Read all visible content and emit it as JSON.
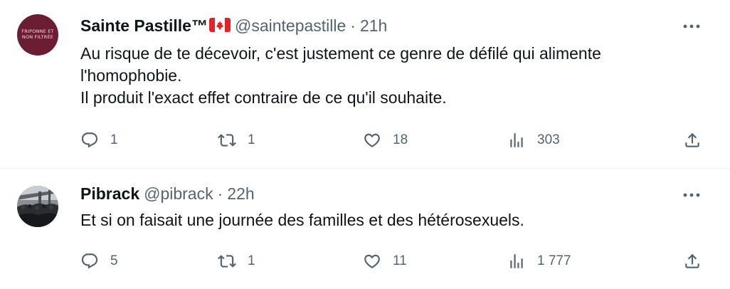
{
  "tweets": [
    {
      "name": "Sainte Pastille™",
      "flag": "canada-flag",
      "handle": "@saintepastille",
      "time": "21h",
      "avatar_text": [
        "FRIPONNE ET",
        "NON FILTRÉE"
      ],
      "lines": [
        "Au risque de te décevoir, c'est justement ce genre de défilé qui alimente",
        "l'homophobie.",
        "Il produit l'exact effet contraire de ce qu'il souhaite."
      ],
      "replies": "1",
      "retweets": "1",
      "likes": "18",
      "views": "303"
    },
    {
      "name": "Pibrack",
      "handle": "@pibrack",
      "time": "22h",
      "lines": [
        "Et si on faisait une journée des familles et des hétérosexuels."
      ],
      "replies": "5",
      "retweets": "1",
      "likes": "11",
      "views": "1 777"
    }
  ],
  "separator": "·",
  "icons": [
    "more-icon",
    "reply-icon",
    "retweet-icon",
    "like-icon",
    "views-icon",
    "share-icon"
  ],
  "colors": {
    "text": "#0f1419",
    "secondary": "#536471",
    "avatar1": "#6b1e33",
    "divider": "#eff3f4"
  }
}
